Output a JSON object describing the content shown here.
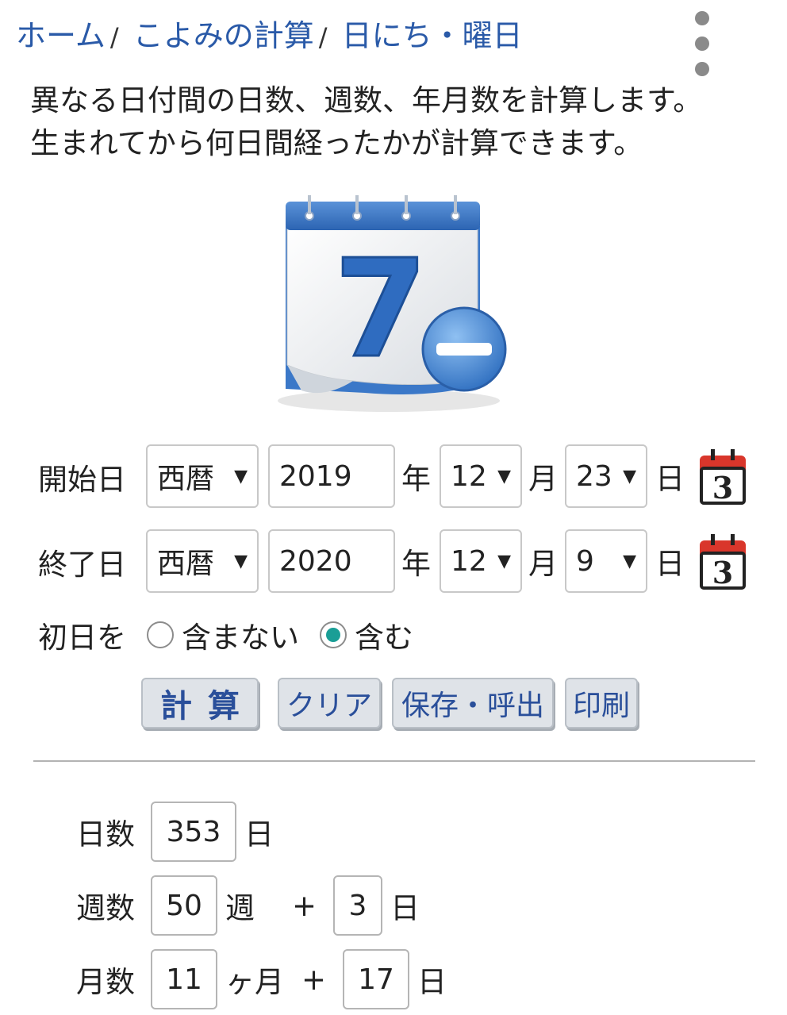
{
  "breadcrumb": {
    "items": [
      "ホーム",
      "こよみの計算",
      "日にち・曜日"
    ],
    "separator": "/"
  },
  "menu_icon": "more-vertical-icon",
  "intro": {
    "line1": "異なる日付間の日数、週数、年月数を計算します。",
    "line2": "生まれてから何日間経ったかが計算できます。"
  },
  "hero_icon": {
    "name": "calendar-subtract-icon",
    "digit": "7"
  },
  "start": {
    "label": "開始日",
    "era": "西暦",
    "year": "2019",
    "year_unit": "年",
    "month": "12",
    "month_unit": "月",
    "day": "23",
    "day_unit": "日",
    "picker_digit": "3"
  },
  "end": {
    "label": "終了日",
    "era": "西暦",
    "year": "2020",
    "year_unit": "年",
    "month": "12",
    "month_unit": "月",
    "day": "9",
    "day_unit": "日",
    "picker_digit": "3"
  },
  "first_day": {
    "label": "初日を",
    "option_exclude": "含まない",
    "option_include": "含む",
    "selected": "含む"
  },
  "buttons": {
    "calc": "計算",
    "clear": "クリア",
    "save_load": "保存・呼出",
    "print": "印刷"
  },
  "results": {
    "days_label": "日数",
    "days_value": "353",
    "days_unit": "日",
    "weeks_label": "週数",
    "weeks_value": "50",
    "weeks_unit": "週",
    "weeks_plus": "+",
    "weeks_rem_value": "3",
    "weeks_rem_unit": "日",
    "months_label": "月数",
    "months_value": "11",
    "months_unit": "ヶ月",
    "months_plus": "+",
    "months_rem_value": "17",
    "months_rem_unit": "日"
  },
  "colors": {
    "link": "#2a5aa8",
    "calendar_blue": "#3b78c8",
    "radio_selected": "#1a9e96",
    "picker_red": "#d9362b"
  }
}
